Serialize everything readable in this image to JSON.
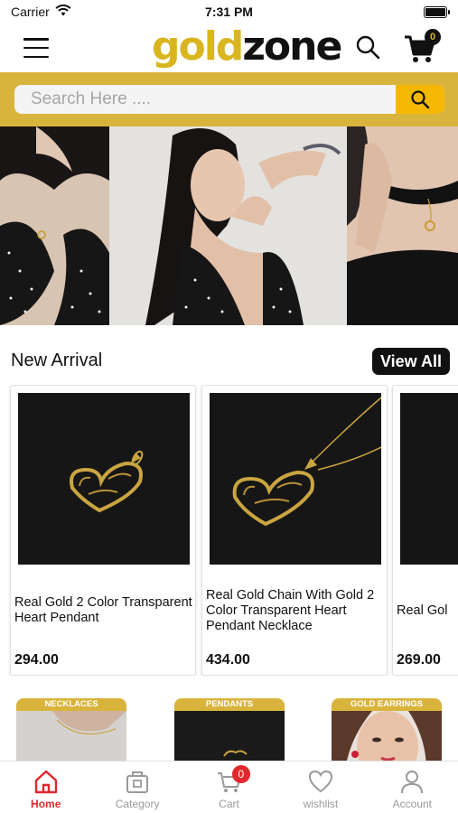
{
  "status_bar": {
    "carrier": "Carrier",
    "time": "7:31 PM"
  },
  "header": {
    "logo_gold": "gold",
    "logo_dark": "zone",
    "cart_count": "0"
  },
  "search": {
    "placeholder": "Search Here ...."
  },
  "new_arrival": {
    "title": "New Arrival",
    "view_all_label": "View All",
    "products": [
      {
        "name": "Real Gold 2 Color Transparent Heart Pendant",
        "price": "294.00"
      },
      {
        "name": "Real Gold Chain With Gold 2 Color Transparent Heart Pendant Necklace",
        "price": "434.00"
      },
      {
        "name": "Real Gol",
        "price": "269.00"
      }
    ]
  },
  "categories": [
    {
      "label": "NECKLACES"
    },
    {
      "label": "PENDANTS"
    },
    {
      "label": "GOLD EARRINGS"
    }
  ],
  "tabbar": {
    "items": [
      {
        "label": "Home",
        "icon": "home-icon"
      },
      {
        "label": "Category",
        "icon": "category-icon"
      },
      {
        "label": "Cart",
        "icon": "cart-icon",
        "badge": "0"
      },
      {
        "label": "wishlist",
        "icon": "heart-icon"
      },
      {
        "label": "Account",
        "icon": "account-icon"
      }
    ]
  },
  "colors": {
    "brand_gold": "#d9b43c",
    "accent_yellow": "#f4b800",
    "active_tab": "#e0282d"
  }
}
